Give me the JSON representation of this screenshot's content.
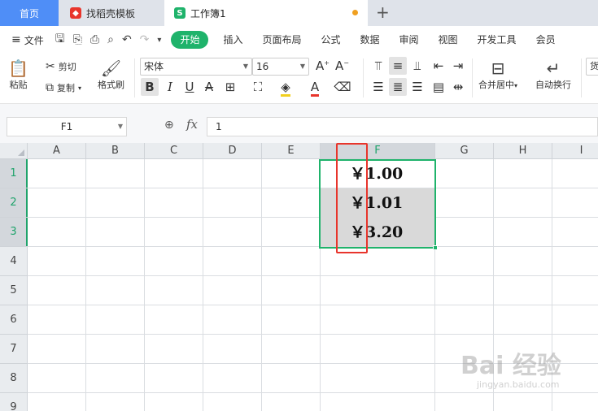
{
  "tabs": {
    "home": "首页",
    "template": "找稻壳模板",
    "workbook": "工作簿1",
    "template_icon_color": "#e8352c",
    "workbook_icon_color": "#1fb36b"
  },
  "menu": {
    "file": "文件",
    "items": [
      "开始",
      "插入",
      "页面布局",
      "公式",
      "数据",
      "审阅",
      "视图",
      "开发工具",
      "会员"
    ]
  },
  "ribbon": {
    "paste": "粘贴",
    "cut": "剪切",
    "copy": "复制",
    "format_painter": "格式刷",
    "font_name": "宋体",
    "font_size": "16",
    "merge_center": "合并居中",
    "wrap_text": "自动换行",
    "number_format": "货"
  },
  "formula_bar": {
    "name_box": "F1",
    "fx_label": "fx",
    "content": "1"
  },
  "sheet": {
    "columns": [
      "A",
      "B",
      "C",
      "D",
      "E",
      "F",
      "G",
      "H",
      "I"
    ],
    "rows": [
      "1",
      "2",
      "3",
      "4",
      "5",
      "6",
      "7",
      "8",
      "9"
    ],
    "selected_column": "F",
    "cells": [
      {
        "ref": "F1",
        "value": "￥1.00"
      },
      {
        "ref": "F2",
        "value": "￥1.01"
      },
      {
        "ref": "F3",
        "value": "￥3.20"
      }
    ],
    "accent": "#1fb36b",
    "highlight": "#e8352c"
  },
  "watermark": {
    "brand": "Bai 经验",
    "url": "jingyan.baidu.com"
  }
}
